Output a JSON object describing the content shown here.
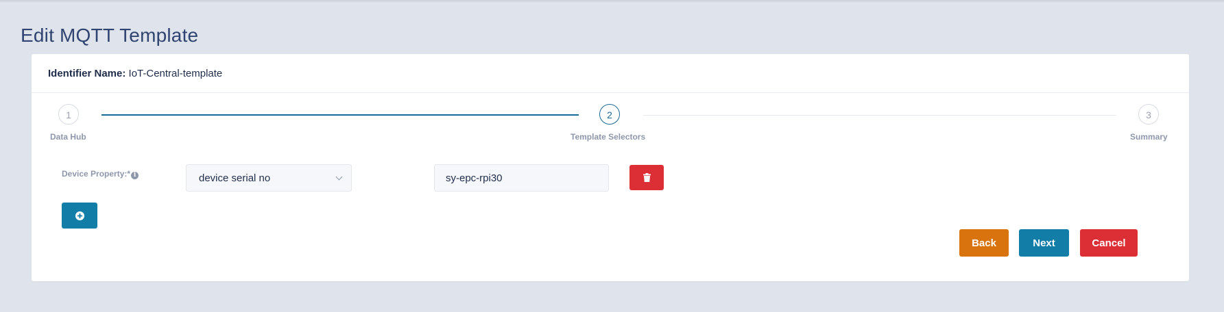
{
  "page": {
    "title": "Edit MQTT Template"
  },
  "identifier": {
    "label": "Identifier Name:",
    "value": "IoT-Central-template"
  },
  "stepper": {
    "current_step": 2,
    "steps": [
      {
        "number": "1",
        "label": "Data Hub"
      },
      {
        "number": "2",
        "label": "Template Selectors"
      },
      {
        "number": "3",
        "label": "Summary"
      }
    ]
  },
  "form": {
    "device_property_label": "Device Property:*",
    "info_icon": "info-circle-icon",
    "select_value": "device serial no",
    "input_value": "sy-epc-rpi30",
    "delete_icon": "trash-icon",
    "add_icon": "plus-circle-icon"
  },
  "actions": {
    "back_label": "Back",
    "next_label": "Next",
    "cancel_label": "Cancel"
  },
  "colors": {
    "primary": "#127ea8",
    "danger": "#dc2f35",
    "warning": "#d9730d",
    "background": "#dfe3ec"
  }
}
